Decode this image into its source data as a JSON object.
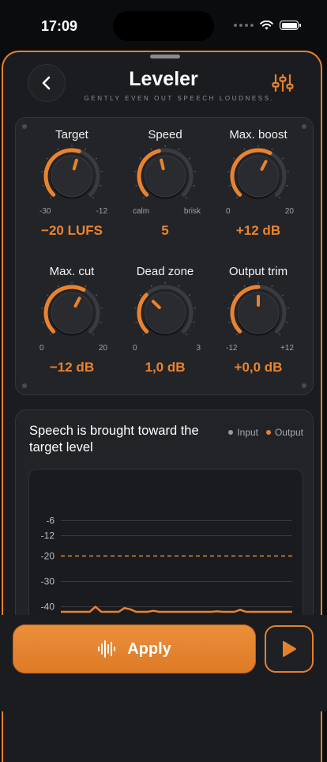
{
  "status": {
    "time": "17:09"
  },
  "header": {
    "title": "Leveler",
    "subtitle": "GENTLY EVEN OUT SPEECH LOUDNESS."
  },
  "colors": {
    "accent": "#e9832f",
    "panel": "#232428",
    "track": "#3a3b40",
    "input": "#9a9ba0"
  },
  "knobs": [
    {
      "label": "Target",
      "min": "-30",
      "max": "-12",
      "value": "−20 LUFS",
      "level": 0.56
    },
    {
      "label": "Speed",
      "min": "calm",
      "max": "brisk",
      "value": "5",
      "level": 0.45
    },
    {
      "label": "Max. boost",
      "min": "0",
      "max": "20",
      "value": "+12 dB",
      "level": 0.6
    },
    {
      "label": "Max. cut",
      "min": "0",
      "max": "20",
      "value": "−12 dB",
      "level": 0.6
    },
    {
      "label": "Dead zone",
      "min": "0",
      "max": "3",
      "value": "1,0 dB",
      "level": 0.33
    },
    {
      "label": "Output trim",
      "min": "-12",
      "max": "+12",
      "value": "+0,0 dB",
      "level": 0.5
    }
  ],
  "chart": {
    "heading": "Speech is brought toward the target level",
    "legend": {
      "input": "Input",
      "output": "Output"
    }
  },
  "chart_data": {
    "type": "line",
    "y_ticks": [
      "-6",
      "-12",
      "-20",
      "-30",
      "-40"
    ],
    "ylim": [
      -42,
      -4
    ],
    "target": -20,
    "x": [
      0,
      1,
      2,
      3,
      4,
      5,
      6,
      7,
      8,
      9,
      10,
      11,
      12,
      13,
      14,
      15,
      16,
      17,
      18,
      19,
      20,
      21,
      22,
      23,
      24,
      25,
      26,
      27,
      28,
      29,
      30,
      31,
      32,
      33,
      34,
      35,
      36,
      37,
      38,
      39,
      40
    ],
    "series": [
      {
        "name": "Output",
        "values": [
          -42,
          -42,
          -42,
          -42,
          -42,
          -42,
          -40,
          -42,
          -42,
          -42,
          -42,
          -40.5,
          -41,
          -42,
          -42,
          -42,
          -41.6,
          -42,
          -42,
          -42,
          -42,
          -42,
          -42,
          -42,
          -42,
          -42,
          -42,
          -41.8,
          -42,
          -42,
          -42,
          -41.2,
          -42,
          -42,
          -42,
          -42,
          -42,
          -42,
          -42,
          -42,
          -42
        ]
      }
    ]
  },
  "actions": {
    "apply": "Apply"
  }
}
